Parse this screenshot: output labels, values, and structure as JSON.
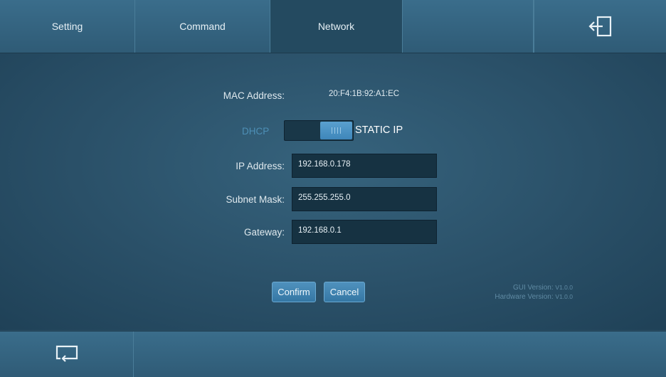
{
  "tabs": [
    {
      "label": "Setting"
    },
    {
      "label": "Command"
    },
    {
      "label": "Network"
    },
    {
      "label": ""
    }
  ],
  "network": {
    "mac_label": "MAC Address:",
    "mac_value": "20:F4:1B:92:A1:EC",
    "dhcp_label": "DHCP",
    "static_label": "STATIC IP",
    "ip_label": "IP Address:",
    "ip_value": "192.168.0.178",
    "subnet_label": "Subnet Mask:",
    "subnet_value": "255.255.255.0",
    "gateway_label": "Gateway:",
    "gateway_value": "192.168.0.1"
  },
  "buttons": {
    "confirm": "Confirm",
    "cancel": "Cancel"
  },
  "version": {
    "gui_label": "GUI Version:",
    "gui_value": "V1.0.0",
    "hw_label": "Hardware Version:",
    "hw_value": "V1.0.0"
  },
  "icons": {
    "exit": "exit-icon",
    "back": "return-icon"
  },
  "colors": {
    "accent": "#4a8fbf",
    "background": "#2a4f66"
  }
}
